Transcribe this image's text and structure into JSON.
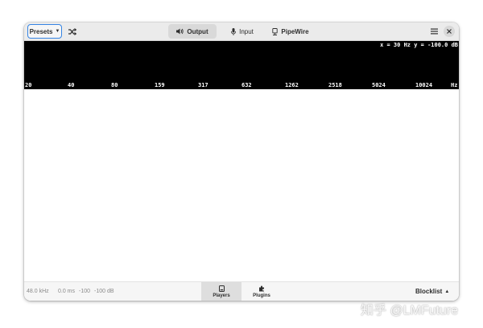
{
  "header": {
    "presets_label": "Presets",
    "tabs": [
      {
        "label": "Output",
        "active": true
      },
      {
        "label": "Input",
        "active": false
      },
      {
        "label": "PipeWire",
        "active": false
      }
    ]
  },
  "spectrum": {
    "readout": "x = 30 Hz y = -100.0 dB",
    "frequencies": [
      "20",
      "40",
      "80",
      "159",
      "317",
      "632",
      "1262",
      "2518",
      "5024",
      "10024"
    ],
    "unit": "Hz"
  },
  "bottombar": {
    "sample_rate": "48.0 kHz",
    "latency": "0.0 ms",
    "level_left": "-100",
    "level_right": "-100",
    "level_unit": "dB",
    "view_switcher": [
      {
        "label": "Players",
        "active": true
      },
      {
        "label": "Plugins",
        "active": false
      }
    ],
    "blocklist_label": "Blocklist"
  },
  "watermark": "知乎 @LMFuture",
  "colors": {
    "accent": "#3584e4",
    "spectrum_bg": "#000000",
    "headerbar_bg": "#ebebeb"
  },
  "icons": [
    "caret-down-icon",
    "shuffle-icon",
    "speaker-icon",
    "microphone-icon",
    "pipewire-icon",
    "hamburger-menu-icon",
    "close-icon",
    "players-icon",
    "plugins-icon",
    "caret-up-icon"
  ]
}
